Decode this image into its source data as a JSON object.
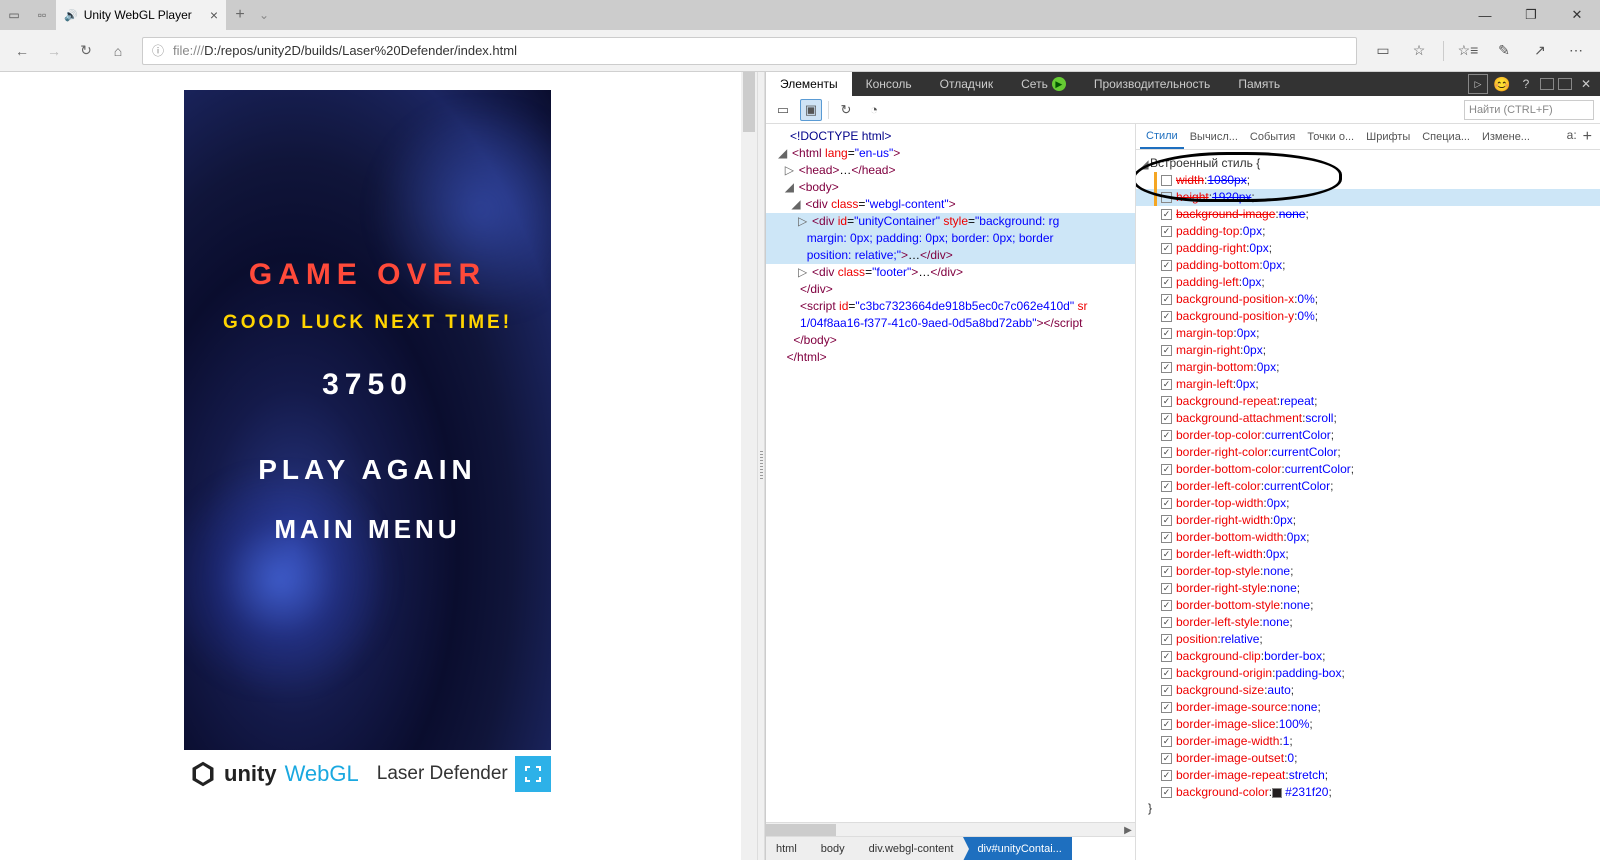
{
  "browser": {
    "tab_title": "Unity WebGL Player",
    "url_protocol": "file:///",
    "url_path": "D:/repos/unity2D/builds/Laser%20Defender/index.html"
  },
  "game": {
    "game_over": "GAME OVER",
    "good_luck": "GOOD LUCK NEXT TIME!",
    "score": "3750",
    "play_again": "PLAY AGAIN",
    "main_menu": "MAIN MENU",
    "unity": "unity",
    "webgl": "WebGL",
    "title": "Laser Defender"
  },
  "devtools": {
    "tabs": {
      "elements": "Элементы",
      "console": "Консоль",
      "debugger": "Отладчик",
      "network": "Сеть",
      "performance": "Производительность",
      "memory": "Память"
    },
    "search_placeholder": "Найти (CTRL+F)",
    "styles_tabs": {
      "styles": "Стили",
      "computed": "Вычисл...",
      "events": "События",
      "breakpoints": "Точки о...",
      "fonts": "Шрифты",
      "accessibility": "Специа...",
      "changes": "Измене..."
    },
    "inline_style_label": "Встроенный стиль",
    "breadcrumbs": {
      "html": "html",
      "body": "body",
      "webgl": "div.webgl-content",
      "container": "div#unityContai..."
    },
    "dom": {
      "doctype": "<!DOCTYPE html>",
      "html_open": "<html lang=\"en-us\">",
      "head": "<head>…</head>",
      "body_open": "<body>",
      "webgl_open": "<div class=\"webgl-content\">",
      "container_l1": "<div id=\"unityContainer\" style=\"background: rg",
      "container_l2": "margin: 0px; padding: 0px; border: 0px; border",
      "container_l3": "position: relative;\">…</div>",
      "footer": "<div class=\"footer\">…</div>",
      "div_close": "</div>",
      "script_l1": "<script id=\"c3bc7323664de918b5ec0c7c062e410d\" sr",
      "script_l2": "1/04f8aa16-f377-41c0-9aed-0d5a8bd72abb\"></script",
      "body_close": "</body>",
      "html_close": "</html>"
    },
    "props": [
      {
        "name": "width",
        "val": "1080px",
        "checked": false,
        "struck": true,
        "bar": true
      },
      {
        "name": "height",
        "val": "1920px",
        "checked": false,
        "struck": true,
        "bar": true,
        "hl": true
      },
      {
        "name": "background-image",
        "val": "none",
        "checked": true,
        "struck": true
      },
      {
        "name": "padding-top",
        "val": "0px",
        "checked": true
      },
      {
        "name": "padding-right",
        "val": "0px",
        "checked": true
      },
      {
        "name": "padding-bottom",
        "val": "0px",
        "checked": true
      },
      {
        "name": "padding-left",
        "val": "0px",
        "checked": true
      },
      {
        "name": "background-position-x",
        "val": "0%",
        "checked": true
      },
      {
        "name": "background-position-y",
        "val": "0%",
        "checked": true
      },
      {
        "name": "margin-top",
        "val": "0px",
        "checked": true
      },
      {
        "name": "margin-right",
        "val": "0px",
        "checked": true
      },
      {
        "name": "margin-bottom",
        "val": "0px",
        "checked": true
      },
      {
        "name": "margin-left",
        "val": "0px",
        "checked": true
      },
      {
        "name": "background-repeat",
        "val": "repeat",
        "checked": true
      },
      {
        "name": "background-attachment",
        "val": "scroll",
        "checked": true
      },
      {
        "name": "border-top-color",
        "val": "currentColor",
        "checked": true
      },
      {
        "name": "border-right-color",
        "val": "currentColor",
        "checked": true
      },
      {
        "name": "border-bottom-color",
        "val": "currentColor",
        "checked": true
      },
      {
        "name": "border-left-color",
        "val": "currentColor",
        "checked": true
      },
      {
        "name": "border-top-width",
        "val": "0px",
        "checked": true
      },
      {
        "name": "border-right-width",
        "val": "0px",
        "checked": true
      },
      {
        "name": "border-bottom-width",
        "val": "0px",
        "checked": true
      },
      {
        "name": "border-left-width",
        "val": "0px",
        "checked": true
      },
      {
        "name": "border-top-style",
        "val": "none",
        "checked": true
      },
      {
        "name": "border-right-style",
        "val": "none",
        "checked": true
      },
      {
        "name": "border-bottom-style",
        "val": "none",
        "checked": true
      },
      {
        "name": "border-left-style",
        "val": "none",
        "checked": true
      },
      {
        "name": "position",
        "val": "relative",
        "checked": true
      },
      {
        "name": "background-clip",
        "val": "border-box",
        "checked": true
      },
      {
        "name": "background-origin",
        "val": "padding-box",
        "checked": true
      },
      {
        "name": "background-size",
        "val": "auto",
        "checked": true
      },
      {
        "name": "border-image-source",
        "val": "none",
        "checked": true
      },
      {
        "name": "border-image-slice",
        "val": "100%",
        "checked": true
      },
      {
        "name": "border-image-width",
        "val": "1",
        "checked": true
      },
      {
        "name": "border-image-outset",
        "val": "0",
        "checked": true
      },
      {
        "name": "border-image-repeat",
        "val": "stretch",
        "checked": true
      },
      {
        "name": "background-color",
        "val": "#231f20",
        "checked": true,
        "swatch": true
      }
    ]
  }
}
